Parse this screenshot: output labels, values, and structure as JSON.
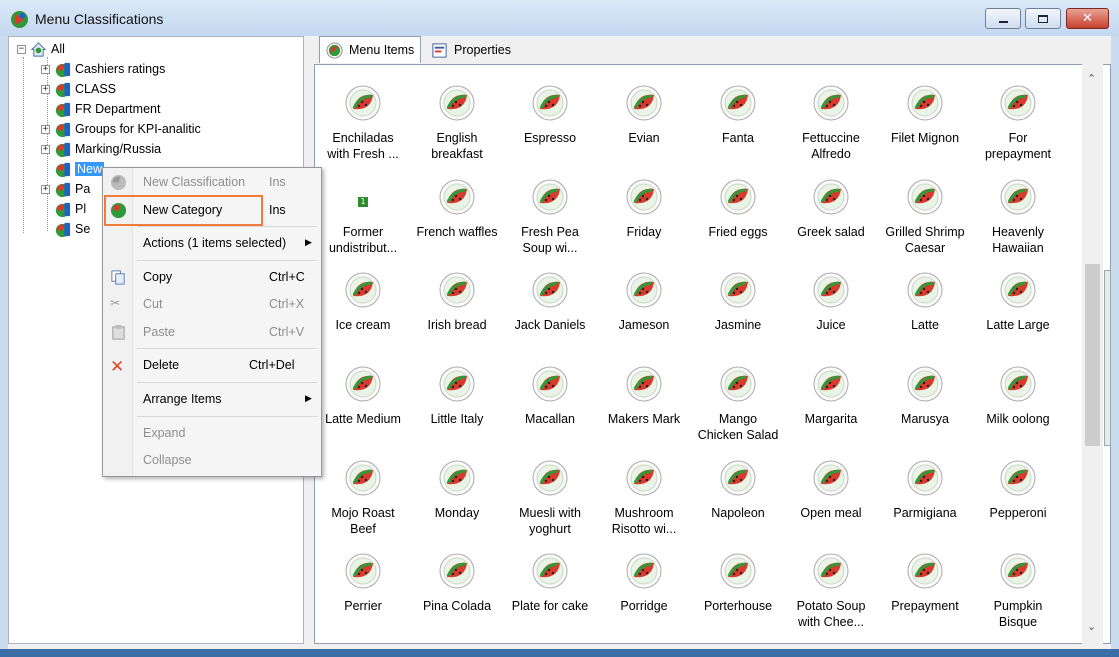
{
  "window": {
    "title": "Menu Classifications",
    "buttons": {
      "minimize": "minimize-icon",
      "maximize": "maximize-icon",
      "close": "close-icon"
    }
  },
  "tree": {
    "root": "All",
    "items": [
      {
        "label": "Cashiers ratings",
        "expander": "+"
      },
      {
        "label": "CLASS",
        "expander": "+"
      },
      {
        "label": "FR Department",
        "expander": ""
      },
      {
        "label": "Groups for KPI-analitic",
        "expander": "+"
      },
      {
        "label": "Marking/Russia",
        "expander": "+"
      },
      {
        "label": "New",
        "expander": "",
        "selected": true
      },
      {
        "label": "Pa",
        "expander": "+"
      },
      {
        "label": "Pl",
        "expander": ""
      },
      {
        "label": "Se",
        "expander": ""
      }
    ]
  },
  "context_menu": {
    "items": [
      {
        "label": "New Classification",
        "shortcut": "Ins",
        "disabled": true
      },
      {
        "label": "New Category",
        "shortcut": "Ins",
        "disabled": false,
        "highlighted": true
      },
      {
        "label": "Actions (1 items selected)",
        "submenu": true
      },
      {
        "label": "Copy",
        "shortcut": "Ctrl+C"
      },
      {
        "label": "Cut",
        "shortcut": "Ctrl+X",
        "disabled": true
      },
      {
        "label": "Paste",
        "shortcut": "Ctrl+V",
        "disabled": true
      },
      {
        "label": "Delete",
        "shortcut": "Ctrl+Del"
      },
      {
        "label": "Arrange Items",
        "submenu": true
      },
      {
        "label": "Expand",
        "disabled": true
      },
      {
        "label": "Collapse",
        "disabled": true
      }
    ],
    "submenu_arrow": "▶"
  },
  "tabs": [
    {
      "label": "Menu Items",
      "active": true
    },
    {
      "label": "Properties",
      "active": false
    }
  ],
  "menu_items": [
    [
      "Enchiladas",
      "with Fresh ..."
    ],
    [
      "English",
      "breakfast"
    ],
    [
      "Espresso"
    ],
    [
      "Evian"
    ],
    [
      "Fanta"
    ],
    [
      "Fettuccine",
      "Alfredo"
    ],
    [
      "Filet Mignon"
    ],
    [
      "For",
      "prepayment"
    ],
    [
      "Former",
      "undistribut..."
    ],
    [
      "French waffles"
    ],
    [
      "Fresh Pea",
      "Soup wi..."
    ],
    [
      "Friday"
    ],
    [
      "Fried eggs"
    ],
    [
      "Greek salad"
    ],
    [
      "Grilled Shrimp",
      "Caesar"
    ],
    [
      "Heavenly",
      "Hawaiian"
    ],
    [
      "Ice cream"
    ],
    [
      "Irish bread"
    ],
    [
      "Jack Daniels"
    ],
    [
      "Jameson"
    ],
    [
      "Jasmine"
    ],
    [
      "Juice"
    ],
    [
      "Latte"
    ],
    [
      "Latte Large"
    ],
    [
      "Latte Medium"
    ],
    [
      "Little Italy"
    ],
    [
      "Macallan"
    ],
    [
      "Makers Mark"
    ],
    [
      "Mango",
      "Chicken Salad"
    ],
    [
      "Margarita"
    ],
    [
      "Marusya"
    ],
    [
      "Milk oolong"
    ],
    [
      "Mojo Roast",
      "Beef"
    ],
    [
      "Monday"
    ],
    [
      "Muesli with",
      "yoghurt"
    ],
    [
      "Mushroom",
      "Risotto wi..."
    ],
    [
      "Napoleon"
    ],
    [
      "Open meal"
    ],
    [
      "Parmigiana"
    ],
    [
      "Pepperoni"
    ],
    [
      "Perrier"
    ],
    [
      "Pina Colada"
    ],
    [
      "Plate for cake"
    ],
    [
      "Porridge"
    ],
    [
      "Porterhouse"
    ],
    [
      "Potato Soup",
      "with Chee..."
    ],
    [
      "Prepayment"
    ],
    [
      "Pumpkin",
      "Bisque"
    ]
  ],
  "former_badge": "1",
  "colors": {
    "accent": "#3399ff",
    "highlight_border": "#f07b3c",
    "watermelon_red": "#d93a2b",
    "leaf_green": "#2e9a3a"
  }
}
